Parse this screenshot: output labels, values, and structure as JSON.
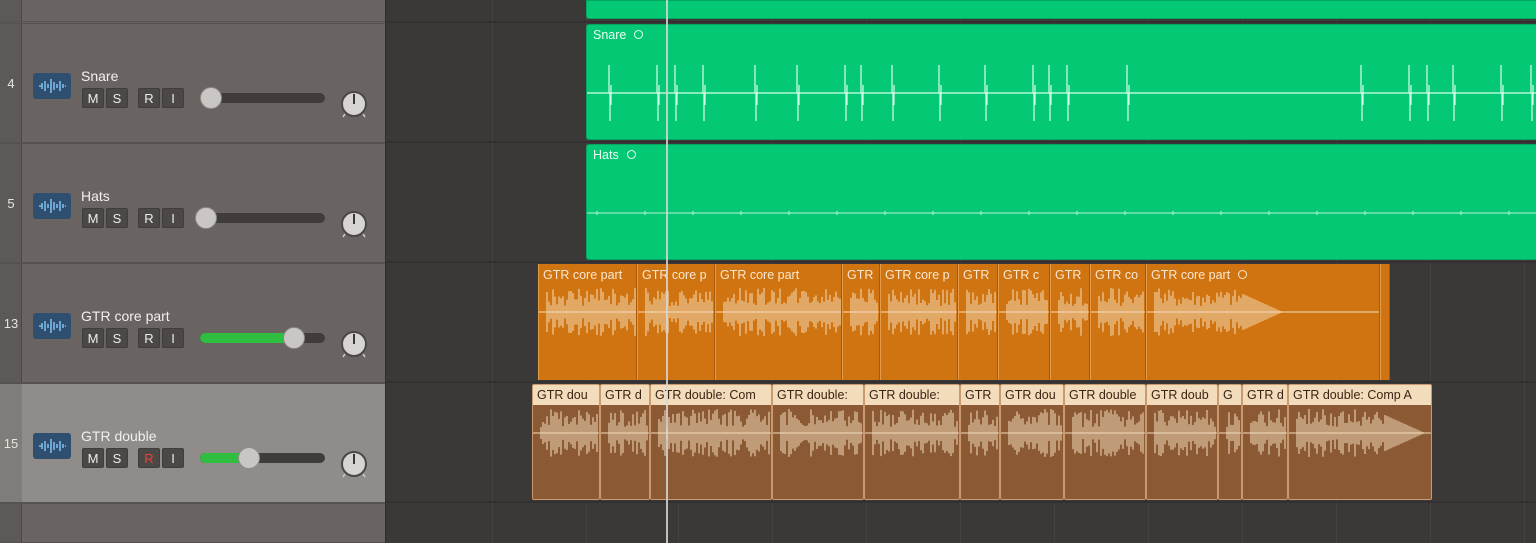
{
  "tracks": [
    {
      "number": "4",
      "name": "Snare",
      "mute": "M",
      "solo": "S",
      "record": "R",
      "input": "I",
      "volume": 0.09,
      "record_armed": false
    },
    {
      "number": "5",
      "name": "Hats",
      "mute": "M",
      "solo": "S",
      "record": "R",
      "input": "I",
      "volume": 0.05,
      "record_armed": false
    },
    {
      "number": "13",
      "name": "GTR core part",
      "mute": "M",
      "solo": "S",
      "record": "R",
      "input": "I",
      "volume": 0.75,
      "record_armed": false
    },
    {
      "number": "15",
      "name": "GTR double",
      "mute": "M",
      "solo": "S",
      "record": "R",
      "input": "I",
      "volume": 0.39,
      "record_armed": true
    }
  ],
  "regions": {
    "snare": {
      "label": "Snare"
    },
    "hats": {
      "label": "Hats"
    },
    "gtr_core": [
      {
        "label": "GTR core part"
      },
      {
        "label": "GTR core p"
      },
      {
        "label": "GTR core part"
      },
      {
        "label": "GTR"
      },
      {
        "label": "GTR core p"
      },
      {
        "label": "GTR"
      },
      {
        "label": "GTR c"
      },
      {
        "label": "GTR"
      },
      {
        "label": "GTR co"
      },
      {
        "label": "GTR core part"
      },
      {
        "label": ""
      }
    ],
    "gtr_double": [
      {
        "label": "GTR dou"
      },
      {
        "label": "GTR d"
      },
      {
        "label": "GTR double: Com"
      },
      {
        "label": "GTR double:"
      },
      {
        "label": "GTR double:"
      },
      {
        "label": "GTR"
      },
      {
        "label": "GTR dou"
      },
      {
        "label": "GTR double"
      },
      {
        "label": "GTR doub"
      },
      {
        "label": "G"
      },
      {
        "label": "GTR d"
      },
      {
        "label": "GTR double: Comp A"
      }
    ]
  },
  "colors": {
    "drums_region": "#04c874",
    "gtr_core_region": "#cf7410",
    "gtr_double_region": "#8b5a35",
    "record_armed": "#e64336",
    "fader_fill": "#2fbe3f"
  },
  "icons": {
    "track_icon": "audio-waveform-icon",
    "pan": "pan-knob-icon"
  }
}
